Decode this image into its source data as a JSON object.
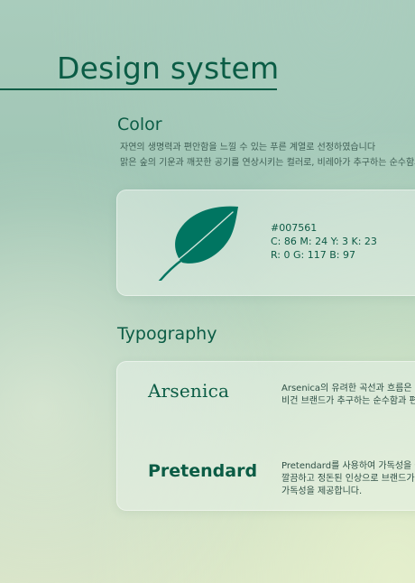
{
  "page": {
    "title": "Design system"
  },
  "color_section": {
    "heading": "Color",
    "description": [
      "자연의 생명력과 편안함을 느낄 수 있는 푸른 계열로 선정하였습니다",
      "맑은 숲의 기운과 깨끗한 공기를 연상시키는 컬러로, 비레아가 추구하는 순수함과"
    ],
    "swatch": {
      "icon": "leaf-icon",
      "color": "#007561",
      "hex": "#007561",
      "cmyk": "C: 86 M: 24 Y: 3 K: 23",
      "rgb": "R: 0 G: 117 B: 97"
    }
  },
  "typography_section": {
    "heading": "Typography",
    "fonts": [
      {
        "name": "Arsenica",
        "description": [
          "Arsenica의 유려한 곡선과 흐름은 비",
          "비건 브랜드가 추구하는 순수함과 편"
        ]
      },
      {
        "name": "Pretendard",
        "description": [
          "Pretendard를 사용하여 가독성을 높",
          "깔끔하고 정돈된 인상으로 브랜드가",
          "가독성을 제공합니다."
        ]
      }
    ]
  }
}
